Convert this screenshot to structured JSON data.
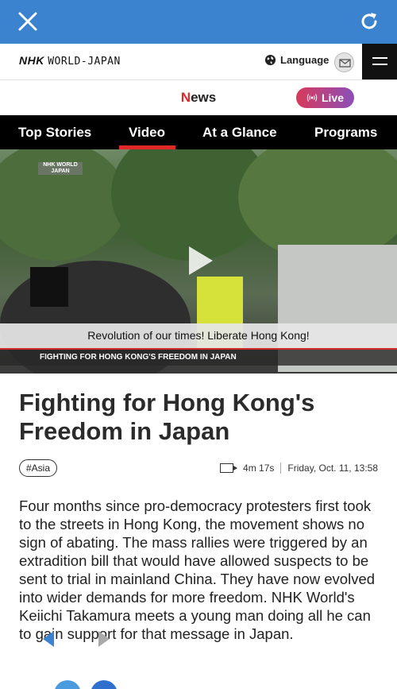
{
  "colors": {
    "browser_bar": "#3b82cf",
    "accent_red": "#e02828",
    "tabs_bg": "#000000"
  },
  "browser": {
    "close_icon": "close-icon",
    "refresh_icon": "refresh-icon"
  },
  "header": {
    "logo_nhk": "NHK",
    "logo_rest": "WORLD-JAPAN",
    "language_label": "Language"
  },
  "news_row": {
    "title_first": "N",
    "title_rest": "ews",
    "live_label": "Live"
  },
  "tabs": [
    {
      "label": "Top Stories"
    },
    {
      "label": "Video"
    },
    {
      "label": "At a Glance"
    },
    {
      "label": "Programs"
    }
  ],
  "video": {
    "watermark": "NHK WORLD JAPAN",
    "subtitle": "Revolution of our times!  Liberate Hong Kong!",
    "caption": "FIGHTING FOR HONG KONG'S FREEDOM IN JAPAN"
  },
  "article": {
    "headline": "Fighting for Hong Kong's Freedom in Japan",
    "tag": "#Asia",
    "duration": "4m 17s",
    "date": "Friday, Oct. 11, 13:58",
    "body": "Four months since pro-democracy protesters first took to the streets in Hong Kong, the movement shows no sign of abating. The mass rallies were triggered by an extradition bill that would have allowed suspects to be sent to trial in mainland China. They have now evolved into wider demands for more freedom. NHK World's Keiichi Takamura meets a young man doing all he can to gain support for that message in Japan."
  }
}
